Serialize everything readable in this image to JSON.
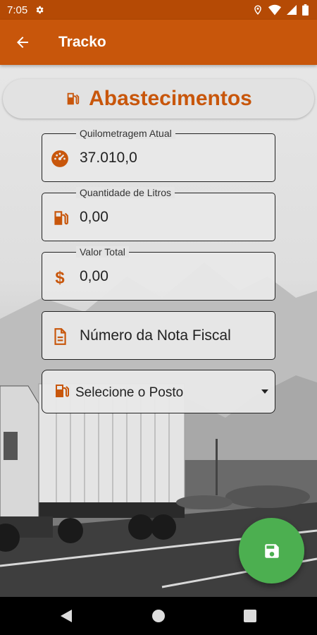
{
  "status_bar": {
    "time": "7:05"
  },
  "app_bar": {
    "title": "Tracko"
  },
  "header": {
    "title": "Abastecimentos"
  },
  "fields": {
    "odometer": {
      "label": "Quilometragem Atual",
      "value": "37.010,0"
    },
    "liters": {
      "label": "Quantidade de Litros",
      "value": "0,00"
    },
    "total": {
      "label": "Valor Total",
      "value": "0,00"
    },
    "invoice": {
      "placeholder": "Número da Nota Fiscal"
    }
  },
  "station_select": {
    "selected": "Selecione o Posto"
  },
  "colors": {
    "accent": "#c8560b",
    "status_bar": "#b54a05",
    "fab": "#4caf50"
  },
  "icons": {
    "status": [
      "gear-icon",
      "location-icon",
      "wifi-icon",
      "signal-icon",
      "battery-icon"
    ],
    "fields": [
      "speedometer-icon",
      "fuel-pump-icon",
      "dollar-icon",
      "document-icon",
      "fuel-pump-icon"
    ],
    "fab": "save-icon"
  }
}
